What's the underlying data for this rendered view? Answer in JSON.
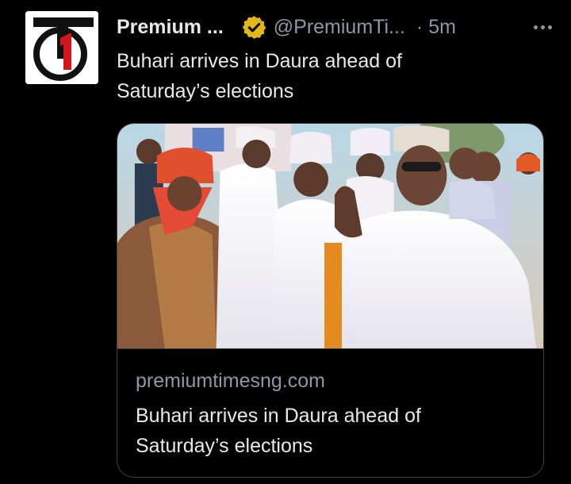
{
  "author": {
    "display_name": "Premium ...",
    "handle": "@PremiumTi...",
    "separator": "·",
    "timestamp": "5m",
    "avatar_letters": "T1"
  },
  "tweet": {
    "text_line1": "Buhari arrives in Daura ahead of",
    "text_line2": "Saturday’s elections"
  },
  "card": {
    "domain": "premiumtimesng.com",
    "title_line1": "Buhari arrives in Daura ahead of",
    "title_line2": "Saturday’s elections"
  },
  "colors": {
    "background": "#000000",
    "text_primary": "#e7e9ea",
    "text_secondary": "#8b98a5",
    "verified_badge": "#e2b719",
    "card_border": "#3e4144"
  }
}
